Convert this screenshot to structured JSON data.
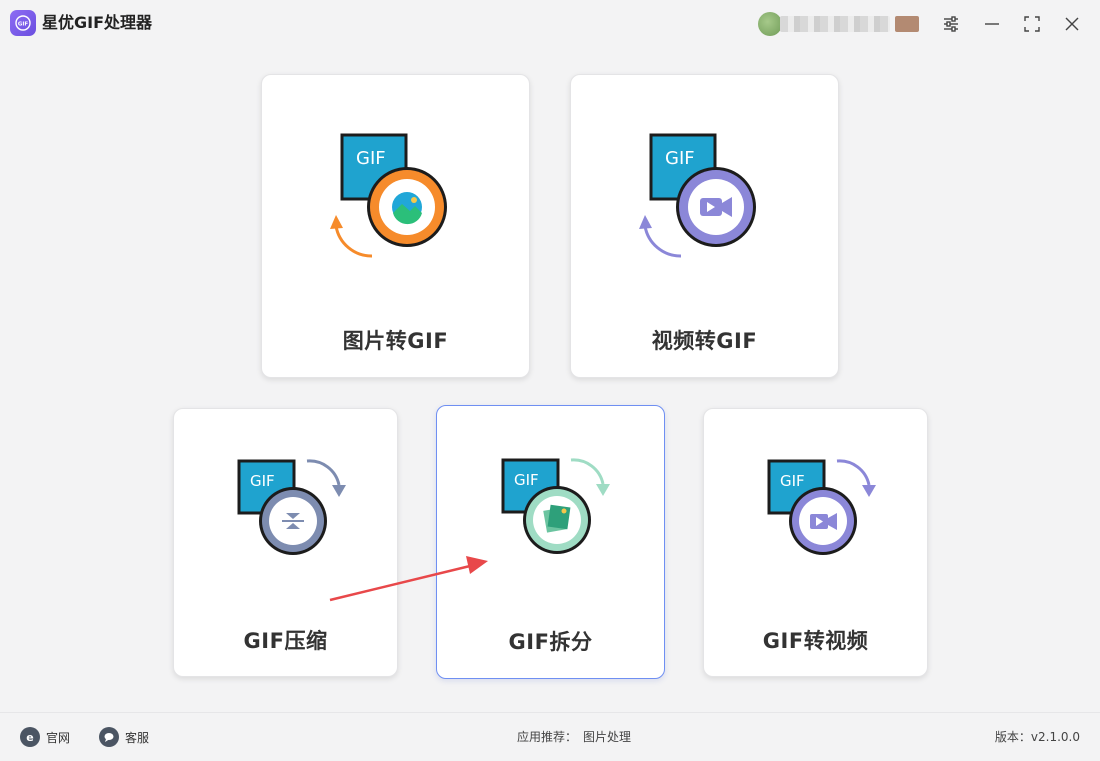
{
  "app": {
    "title": "星优GIF处理器",
    "logo_text": "GIF"
  },
  "cards": {
    "image_to_gif": {
      "label": "图片转GIF",
      "badge": "GIF"
    },
    "video_to_gif": {
      "label": "视频转GIF",
      "badge": "GIF"
    },
    "gif_compress": {
      "label": "GIF压缩",
      "badge": "GIF"
    },
    "gif_split": {
      "label": "GIF拆分",
      "badge": "GIF"
    },
    "gif_to_video": {
      "label": "GIF转视频",
      "badge": "GIF"
    }
  },
  "footer": {
    "website": "官网",
    "support": "客服",
    "recommend_label": "应用推荐：",
    "recommend_link": "图片处理",
    "version": "版本：v2.1.0.0"
  },
  "colors": {
    "orange": "#f68b2b",
    "purple": "#8b87d8",
    "slate": "#7d8cb0",
    "mint": "#9fdcc4",
    "blue": "#1fa3cf",
    "selected_border": "#6f8ff2",
    "annotation_arrow": "#e8484a"
  }
}
